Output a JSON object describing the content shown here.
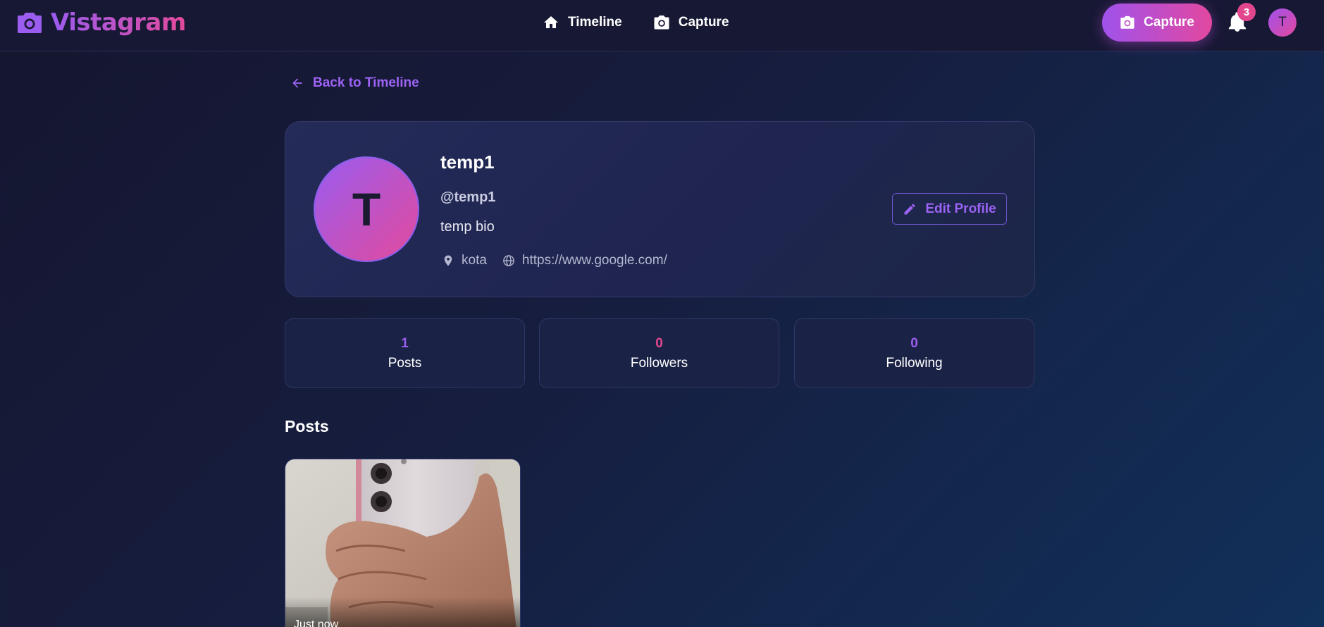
{
  "app": {
    "name": "Vistagram"
  },
  "nav": {
    "links": [
      {
        "label": "Timeline",
        "icon": "home-icon"
      },
      {
        "label": "Capture",
        "icon": "camera-icon"
      }
    ],
    "capture_button": "Capture",
    "notification_count": "3",
    "avatar_initial": "T"
  },
  "back_link": "Back to Timeline",
  "profile": {
    "avatar_initial": "T",
    "name": "temp1",
    "handle": "@temp1",
    "bio": "temp bio",
    "location": "kota",
    "website": "https://www.google.com/",
    "edit_button": "Edit Profile"
  },
  "stats": {
    "posts": {
      "value": "1",
      "label": "Posts",
      "color": "#9b5cf0"
    },
    "followers": {
      "value": "0",
      "label": "Followers",
      "color": "#e2478e"
    },
    "following": {
      "value": "0",
      "label": "Following",
      "color": "#9b5cf0"
    }
  },
  "posts_section": {
    "heading": "Posts",
    "items": [
      {
        "time": "Just now"
      }
    ]
  },
  "colors": {
    "accent_purple": "#9b5cf0",
    "accent_pink": "#e2489f"
  }
}
